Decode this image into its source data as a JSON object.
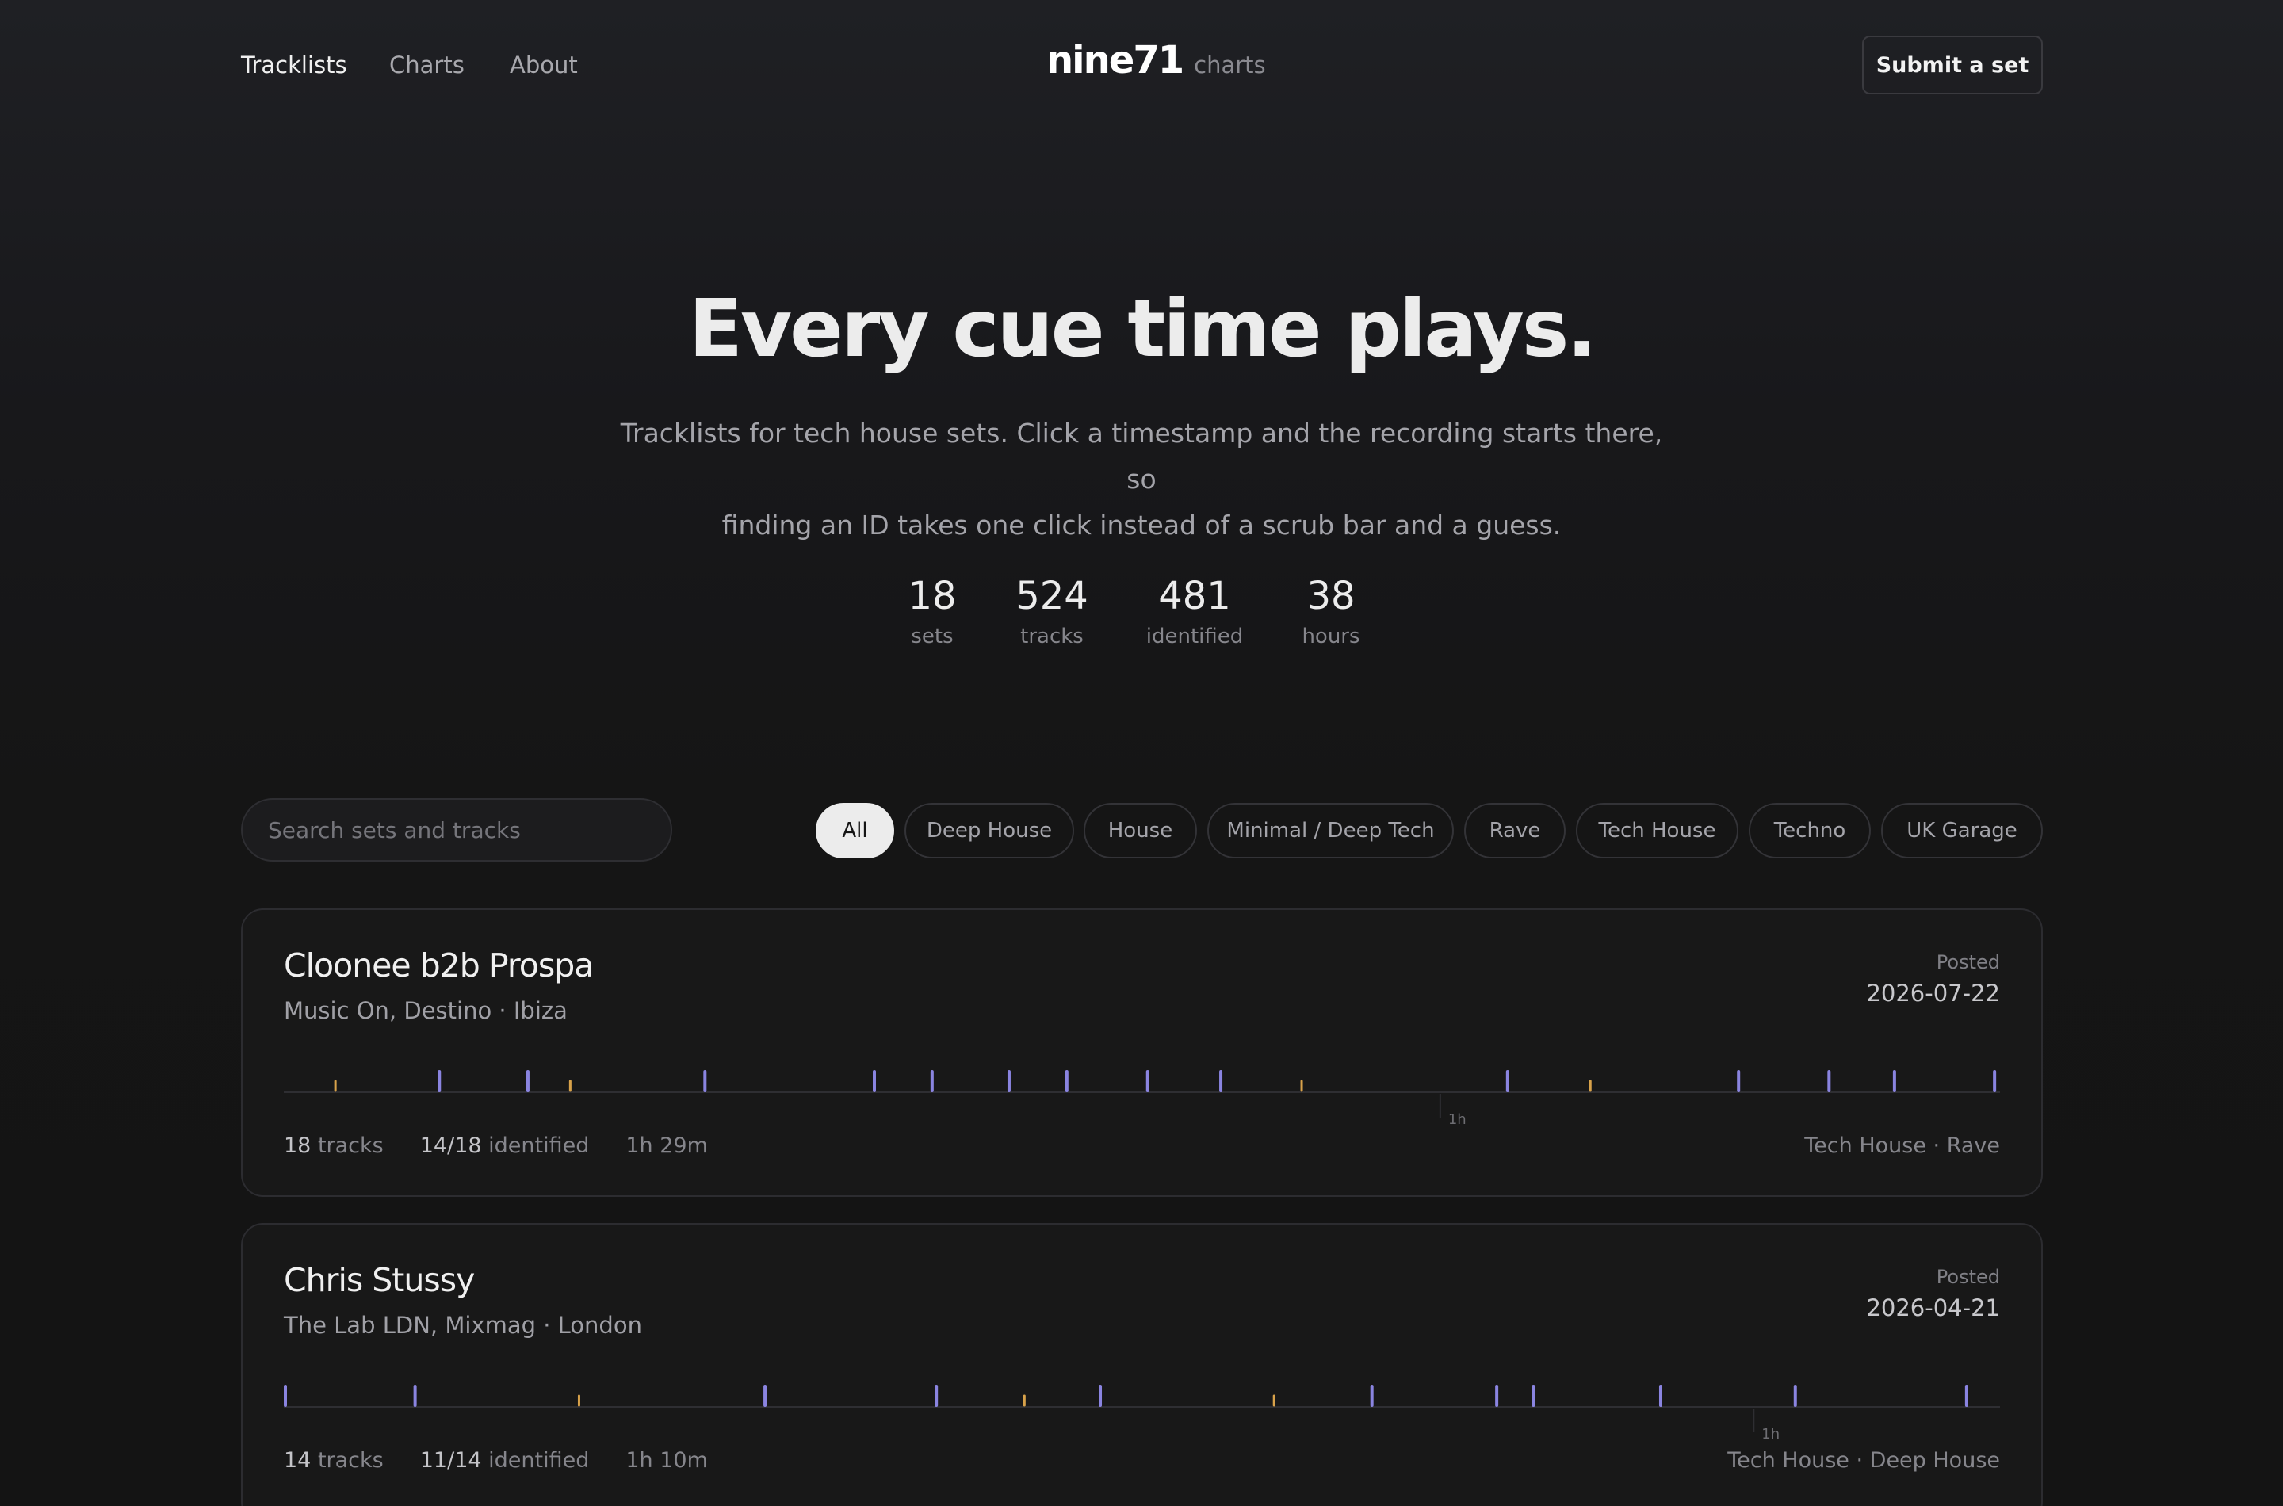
{
  "nav": {
    "links": [
      "Tracklists",
      "Charts",
      "About"
    ],
    "logo_main": "nine71",
    "logo_sub": "charts",
    "submit_label": "Submit a set"
  },
  "hero": {
    "title": "Every cue time plays.",
    "subtitle_line1": "Tracklists for tech house sets. Click a timestamp and the recording starts there, so",
    "subtitle_line2": "finding an ID takes one click instead of a scrub bar and a guess.",
    "stats": [
      {
        "value": "18",
        "label": "sets"
      },
      {
        "value": "524",
        "label": "tracks"
      },
      {
        "value": "481",
        "label": "identified"
      },
      {
        "value": "38",
        "label": "hours"
      }
    ]
  },
  "filters": {
    "search_placeholder": "Search sets and tracks",
    "chips": [
      "All",
      "Deep House",
      "House",
      "Minimal / Deep Tech",
      "Rave",
      "Tech House",
      "Techno",
      "UK Garage"
    ],
    "active": "All"
  },
  "colors": {
    "identified": "#8a84e0",
    "unidentified": "#d8a24a",
    "background": "#141414"
  },
  "sets": [
    {
      "title": "Cloonee b2b Prospa",
      "venue": "Music On, Destino · Ibiza",
      "posted_label": "Posted",
      "posted_date": "2026-07-22",
      "tracks_num": "18",
      "tracks_label": "tracks",
      "identified_num": "14/18",
      "identified_label": "identified",
      "duration": "1h 29m",
      "genres": "Tech House · Rave",
      "hour_marker": "1h",
      "duration_minutes": 89,
      "cues": [
        {
          "minute": 2.6,
          "identified": false
        },
        {
          "minute": 8.0,
          "identified": true
        },
        {
          "minute": 12.6,
          "identified": true
        },
        {
          "minute": 14.8,
          "identified": false
        },
        {
          "minute": 21.8,
          "identified": true
        },
        {
          "minute": 30.6,
          "identified": true
        },
        {
          "minute": 33.6,
          "identified": true
        },
        {
          "minute": 37.6,
          "identified": true
        },
        {
          "minute": 40.6,
          "identified": true
        },
        {
          "minute": 44.8,
          "identified": true
        },
        {
          "minute": 48.6,
          "identified": true
        },
        {
          "minute": 52.8,
          "identified": false
        },
        {
          "minute": 63.5,
          "identified": true
        },
        {
          "minute": 67.8,
          "identified": false
        },
        {
          "minute": 75.5,
          "identified": true
        },
        {
          "minute": 80.2,
          "identified": true
        },
        {
          "minute": 83.6,
          "identified": true
        },
        {
          "minute": 88.8,
          "identified": true
        }
      ]
    },
    {
      "title": "Chris Stussy",
      "venue": "The Lab LDN, Mixmag · London",
      "posted_label": "Posted",
      "posted_date": "2026-04-21",
      "tracks_num": "14",
      "tracks_label": "tracks",
      "identified_num": "11/14",
      "identified_label": "identified",
      "duration": "1h 10m",
      "genres": "Tech House · Deep House",
      "hour_marker": "1h",
      "duration_minutes": 70,
      "cues": [
        {
          "minute": 0.0,
          "identified": true
        },
        {
          "minute": 5.3,
          "identified": true
        },
        {
          "minute": 12.0,
          "identified": false
        },
        {
          "minute": 19.6,
          "identified": true
        },
        {
          "minute": 26.6,
          "identified": true
        },
        {
          "minute": 30.2,
          "identified": false
        },
        {
          "minute": 33.3,
          "identified": true
        },
        {
          "minute": 40.4,
          "identified": false
        },
        {
          "minute": 44.4,
          "identified": true
        },
        {
          "minute": 49.5,
          "identified": true
        },
        {
          "minute": 51.0,
          "identified": true
        },
        {
          "minute": 56.2,
          "identified": true
        },
        {
          "minute": 61.7,
          "identified": true
        },
        {
          "minute": 68.7,
          "identified": true
        }
      ]
    }
  ]
}
